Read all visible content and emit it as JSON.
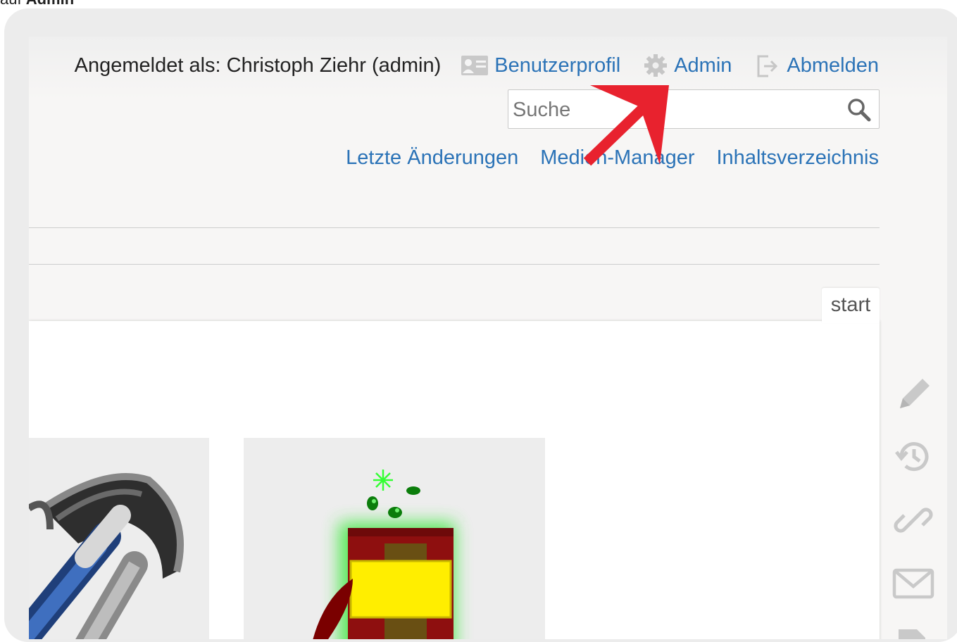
{
  "top_caption": {
    "prefix": "auf",
    "bold": "Admin"
  },
  "usertools": {
    "login_text": "Angemeldet als: Christoph Ziehr (admin)",
    "profile_label": "Benutzerprofil",
    "admin_label": "Admin",
    "logout_label": "Abmelden"
  },
  "search": {
    "placeholder": "Suche",
    "value": ""
  },
  "sitetools": {
    "recent_label": "Letzte Änderungen",
    "media_label": "Medien-Manager",
    "index_label": "Inhaltsverzeichnis"
  },
  "page_tab": {
    "label": "start"
  },
  "page_tools": [
    "edit-icon",
    "history-icon",
    "backlink-icon",
    "mail-icon",
    "document-icon"
  ],
  "colors": {
    "link": "#2b73b7",
    "annotation_arrow": "#e8222e",
    "frame": "#ececec"
  }
}
